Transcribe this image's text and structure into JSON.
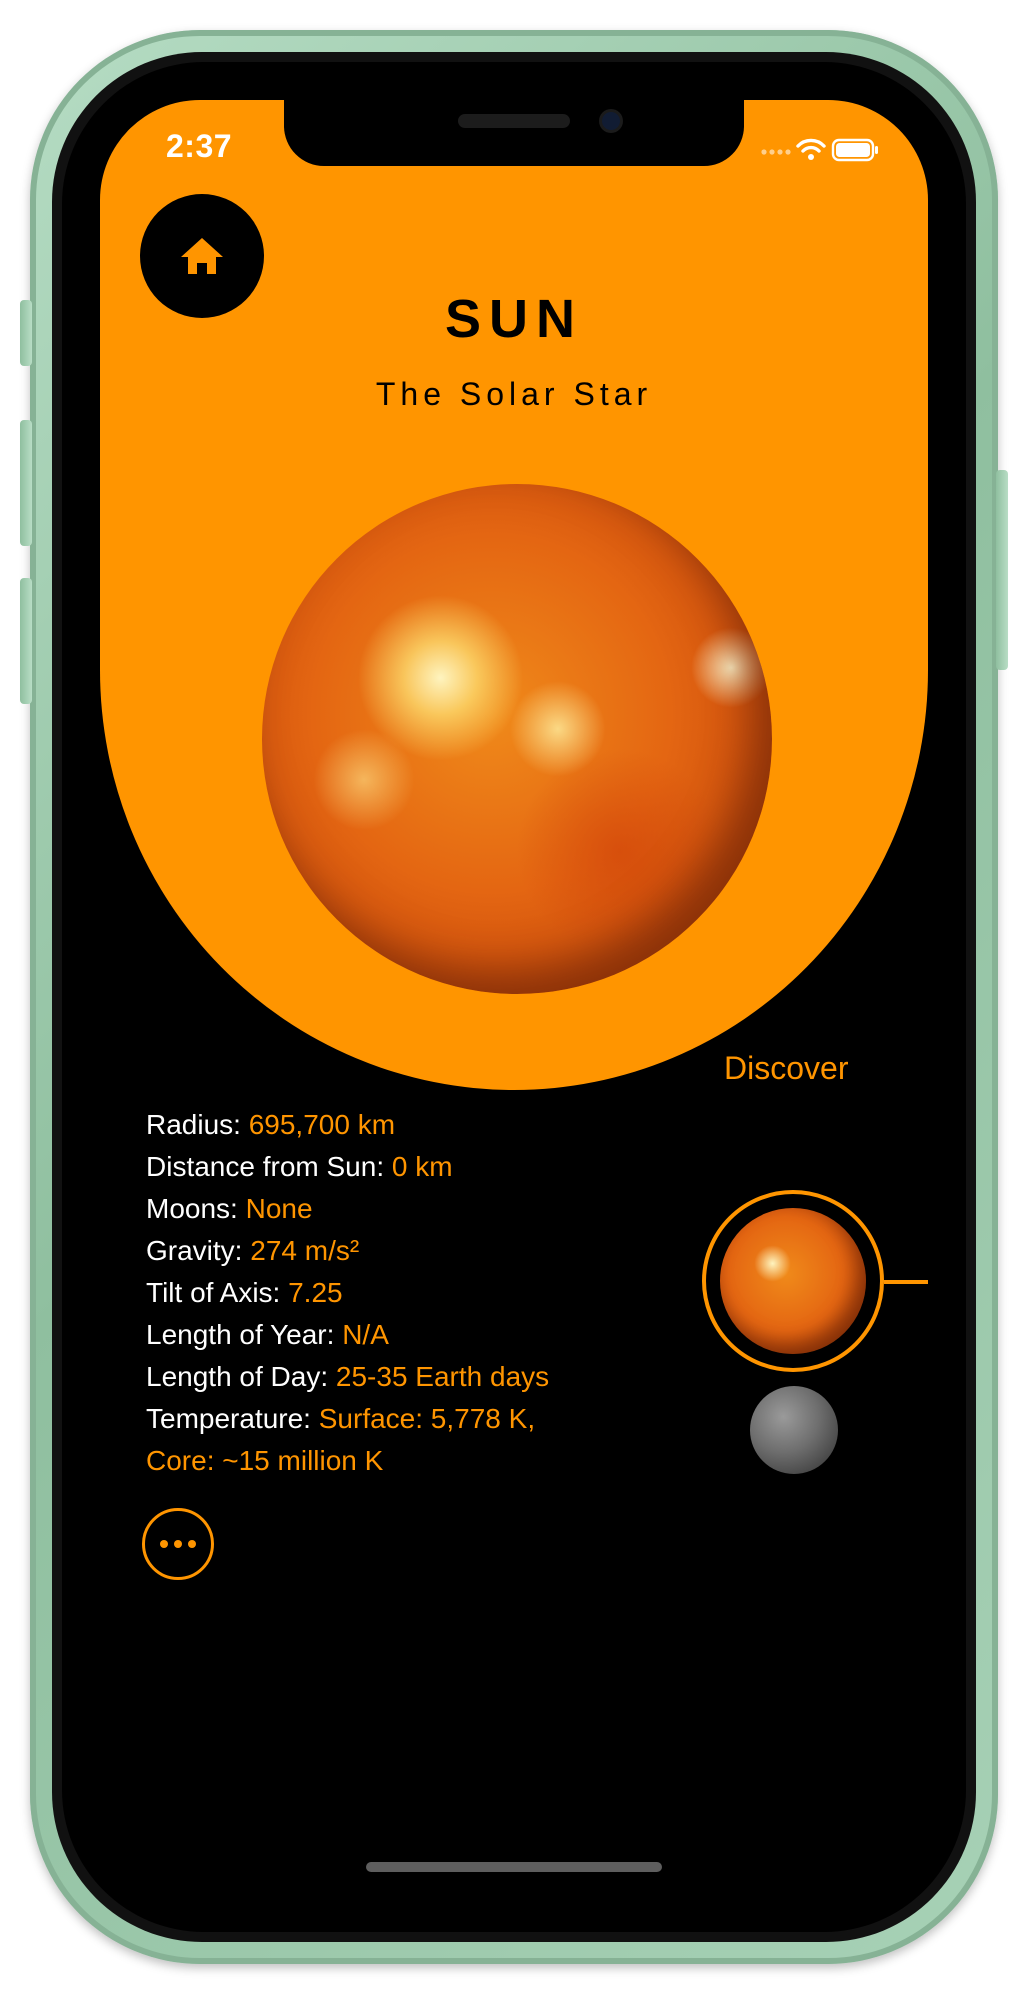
{
  "status_bar": {
    "time": "2:37"
  },
  "header": {
    "title": "SUN",
    "subtitle": "The Solar Star"
  },
  "discover_label": "Discover",
  "facts": [
    {
      "label": "Radius:",
      "value": "695,700 km"
    },
    {
      "label": "Distance from Sun:",
      "value": "0 km"
    },
    {
      "label": "Moons:",
      "value": "None"
    },
    {
      "label": "Gravity:",
      "value": "274 m/s²"
    },
    {
      "label": "Tilt of Axis:",
      "value": "7.25"
    },
    {
      "label": "Length of Year:",
      "value": "N/A"
    },
    {
      "label": "Length of Day:",
      "value": "25-35 Earth days"
    },
    {
      "label": "Temperature:",
      "value": "Surface: 5,778 K,",
      "value_line2": "Core: ~15 million K"
    }
  ],
  "colors": {
    "accent": "#ff9500",
    "background": "#000000",
    "text": "#ffffff"
  },
  "icons": {
    "home": "home-icon",
    "more": "ellipsis-icon",
    "wifi": "wifi-icon",
    "battery": "battery-icon",
    "signal": "signal-icon"
  }
}
